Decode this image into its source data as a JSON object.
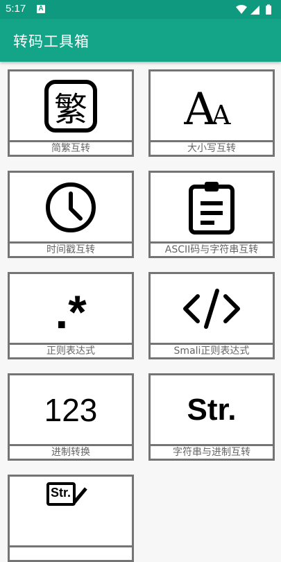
{
  "status": {
    "time": "5:17",
    "notification_icon": "A"
  },
  "appbar": {
    "title": "转码工具箱"
  },
  "tools": [
    {
      "label": "简繁互转",
      "icon": "traditional-char-icon",
      "glyph": "繁"
    },
    {
      "label": "大小写互转",
      "icon": "font-case-icon",
      "glyph": "A"
    },
    {
      "label": "时间戳互转",
      "icon": "clock-icon"
    },
    {
      "label": "ASCII码与字符串互转",
      "icon": "clipboard-icon"
    },
    {
      "label": "正则表达式",
      "icon": "regex-icon",
      "glyph": ".*"
    },
    {
      "label": "Smali正则表达式",
      "icon": "code-icon",
      "glyph": "</>"
    },
    {
      "label": "进制转换",
      "icon": "number-icon",
      "glyph": "123"
    },
    {
      "label": "字符串与进制互转",
      "icon": "string-icon",
      "glyph": "Str."
    },
    {
      "label": "",
      "icon": "string-edit-icon",
      "glyph": "Str."
    }
  ],
  "colors": {
    "statusbar": "#0f9a7f",
    "appbar": "#14a488",
    "card_border": "#747474"
  }
}
